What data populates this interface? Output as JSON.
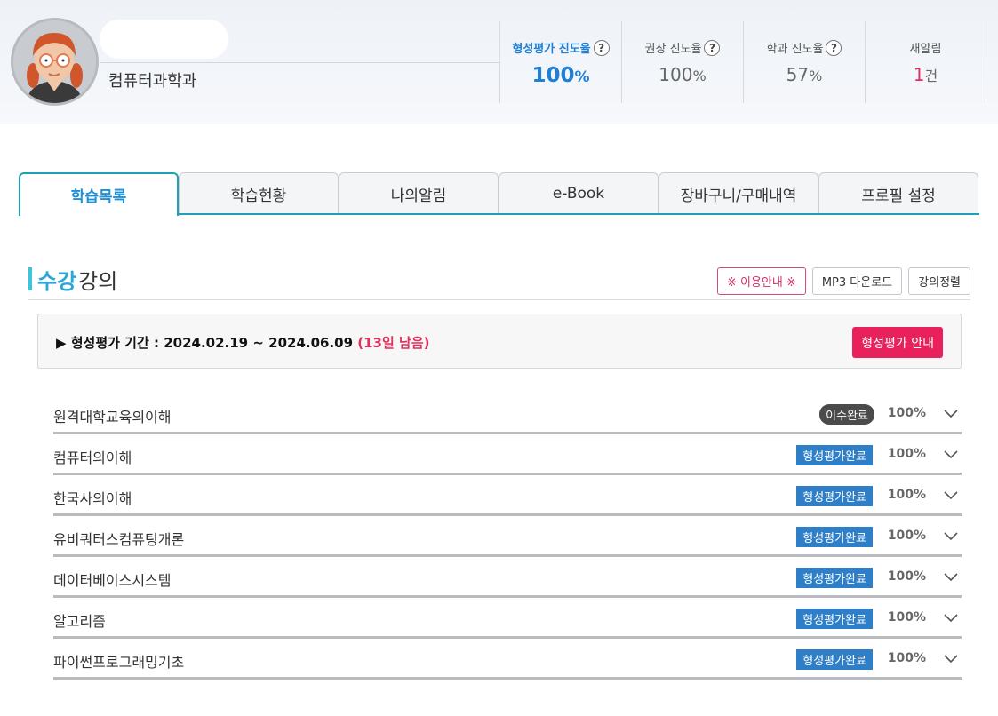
{
  "profile": {
    "department": "컴퓨터과학과"
  },
  "stats": [
    {
      "label": "형성평가 진도율",
      "value": "100",
      "unit": "%",
      "help": "?"
    },
    {
      "label": "권장 진도율",
      "value": "100",
      "unit": "%",
      "help": "?"
    },
    {
      "label": "학과 진도율",
      "value": "57",
      "unit": "%",
      "help": "?"
    },
    {
      "label": "새알림",
      "value": "1",
      "unit": "건"
    }
  ],
  "tabs": [
    "학습목록",
    "학습현황",
    "나의알림",
    "e-Book",
    "장바구니/구매내역",
    "프로필 설정"
  ],
  "section": {
    "title_highlight": "수강",
    "title_rest": "강의",
    "buttons": [
      "※ 이용안내 ※",
      "MP3 다운로드",
      "강의정렬"
    ]
  },
  "period": {
    "text": "▶ 형성평가 기간 : 2024.02.19 ~ 2024.06.09",
    "remaining": "(13일 남음)",
    "guide_button": "형성평가 안내"
  },
  "courses": [
    {
      "name": "원격대학교육의이해",
      "badge": "이수완료",
      "progress": "100%"
    },
    {
      "name": "컴퓨터의이해",
      "badge": "형성평가완료",
      "progress": "100%"
    },
    {
      "name": "한국사의이해",
      "badge": "형성평가완료",
      "progress": "100%"
    },
    {
      "name": "유비쿼터스컴퓨팅개론",
      "badge": "형성평가완료",
      "progress": "100%"
    },
    {
      "name": "데이터베이스시스템",
      "badge": "형성평가완료",
      "progress": "100%"
    },
    {
      "name": "알고리즘",
      "badge": "형성평가완료",
      "progress": "100%"
    },
    {
      "name": "파이썬프로그래밍기초",
      "badge": "형성평가완료",
      "progress": "100%"
    }
  ],
  "colors": {
    "accent_blue": "#1f7fd6",
    "tab_accent": "#1ea0b8",
    "alert_pink": "#e8215d",
    "badge_eval": "#2f7fc8",
    "badge_done": "#4b4b4b"
  }
}
